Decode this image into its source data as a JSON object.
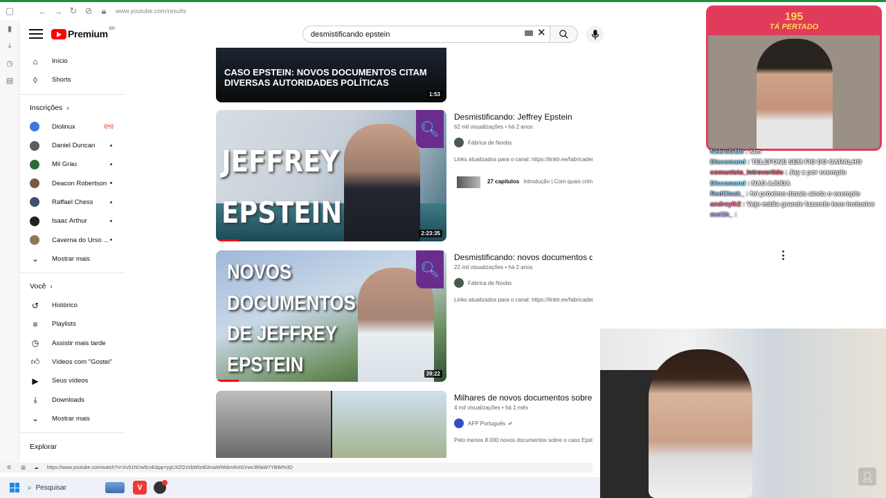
{
  "browser": {
    "url": "www.youtube.com/results"
  },
  "header": {
    "logo_word": "Premium",
    "region": "BR",
    "search_value": "desmistificando epstein"
  },
  "sidebar": {
    "items": [
      {
        "label": "Início"
      },
      {
        "label": "Shorts"
      }
    ],
    "subscriptions_title": "Inscrições",
    "subscriptions": [
      {
        "label": "Diolinux",
        "color": "#3f78d8",
        "status": "live"
      },
      {
        "label": "Daniel Duncan",
        "color": "#5d5d5d",
        "status": "dot"
      },
      {
        "label": "Mil Grau",
        "color": "#2e6b3a",
        "status": "dot"
      },
      {
        "label": "Deacon Robertson",
        "color": "#7a5a3d",
        "status": "dot"
      },
      {
        "label": "Raffael Chess",
        "color": "#3d4f6b",
        "status": "dot"
      },
      {
        "label": "Isaac Arthur",
        "color": "#222",
        "status": "dot"
      },
      {
        "label": "Caverna do Urso ...",
        "color": "#8a7a56",
        "status": "dot"
      }
    ],
    "show_more": "Mostrar mais",
    "you_title": "Você",
    "you_items": [
      {
        "label": "Histórico"
      },
      {
        "label": "Playlists"
      },
      {
        "label": "Assistir mais tarde"
      },
      {
        "label": "Vídeos com \"Gostei\""
      },
      {
        "label": "Seus vídeos"
      },
      {
        "label": "Downloads"
      },
      {
        "label": "Mostrar mais"
      }
    ],
    "explore_title": "Explorar"
  },
  "results": [
    {
      "thumb_text": "CASO EPSTEIN: NOVOS DOCUMENTOS CITAM DIVERSAS AUTORIDADES POLÍTICAS",
      "duration": "1:53"
    },
    {
      "title": "Desmistificando: Jeffrey Epstein",
      "meta": "62 mil visualizações • há 2 anos",
      "channel": "Fábrica de Noobs",
      "desc": "Links atualizados para o canal: https://linktr.ee/fabricadenoobs Jeffrey Epstein foi um bilionário americano",
      "chapters": "27 capítulos",
      "chapters_desc": "Introdução | Com quais crimes estamos lidando? | O que Epstein fazia antes",
      "thumb_text": [
        "JEFFREY",
        "EPSTEIN"
      ],
      "duration": "2:23:35",
      "progress": 0.1
    },
    {
      "title": "Desmistificando: novos documentos de Jeffrey Epstein",
      "meta": "22 mil visualizações • há 2 anos",
      "channel": "Fábrica de Noobs",
      "desc": "Links atualizados para o canal: https://linktr.ee/fabricadenoobs Novos documentos publicados sobre o caso de Jeffrey Epstein ...",
      "thumb_text": [
        "NOVOS",
        "DOCUMENTOS",
        "DE JEFFREY",
        "EPSTEIN"
      ],
      "duration": "39:22",
      "progress": 0.1
    },
    {
      "title": "Milhares de novos documentos sobre",
      "meta": "4 mil visualizações • há 1 mês",
      "channel": "AFP Português",
      "desc": "Pelo menos 8.000 novos documentos sobre o caso Epst"
    }
  ],
  "status_url": "https://www.youtube.com/watch?v=Xv51NUw5cxE&pp=ygUXZGVzbWlzdGlmaWNhbmRvIGVwc3RlaW7YBiM%3D",
  "taskbar": {
    "search_placeholder": "Pesquisar"
  },
  "overlay": {
    "counter": "195",
    "counter_label": "TÁ PERTADO",
    "chat": [
      {
        "name": "NekruG1to",
        "msg": " : sim"
      },
      {
        "name": "Dlccomand",
        "msg": " : TELEFONE SEM FIO DO CARALHO"
      },
      {
        "name": "comunista_introvertido",
        "msg": " : Jay z por exemplo"
      },
      {
        "name": "Dlccomand",
        "msg": " : NAO AJUDA"
      },
      {
        "name": "RedCloak_",
        "msg": " : foi próximo dmais ainda o exemplo"
      },
      {
        "name": "andreylk2",
        "msg": " : Vejo mídia grande fazendo isso inclusive"
      },
      {
        "name": "mei1h_",
        "msg": " : "
      }
    ]
  }
}
